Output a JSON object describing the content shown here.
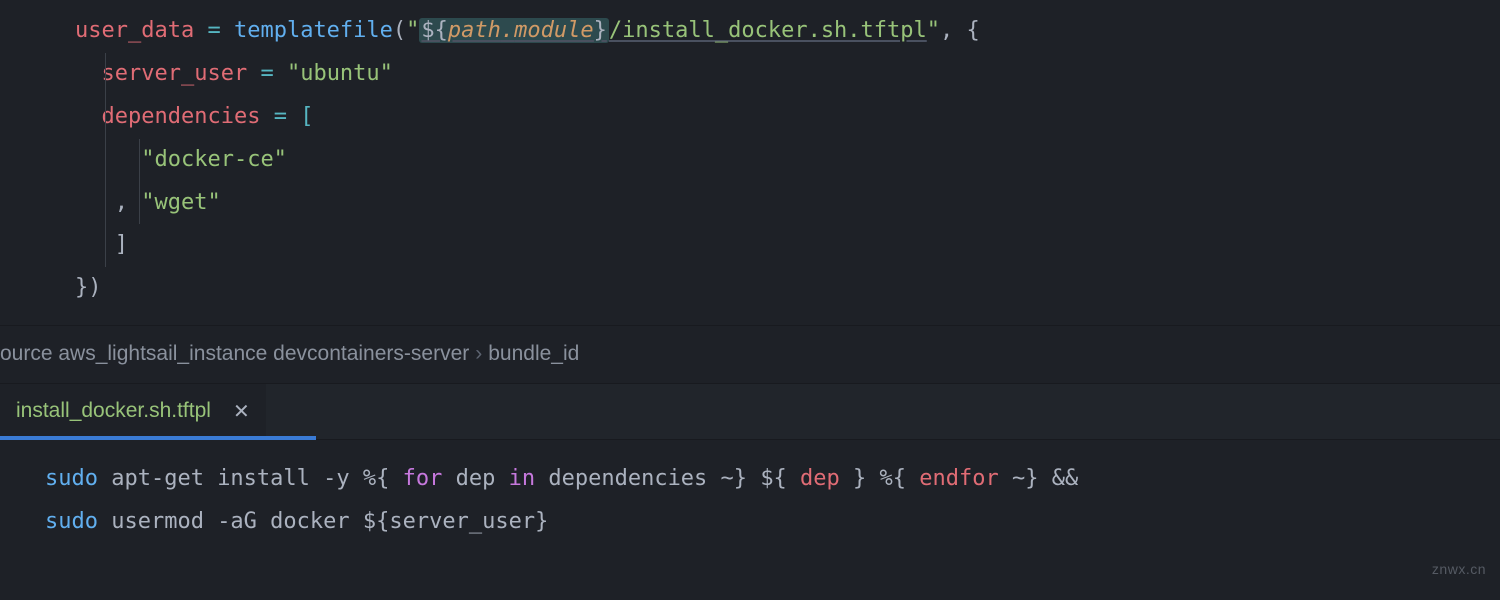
{
  "code_top": {
    "l1": {
      "key": "user_data",
      "eq": " = ",
      "fn": "templatefile",
      "open": "(",
      "q1": "\"",
      "interp_open": "${",
      "path": "path",
      "dot": ".",
      "module": "module",
      "interp_close": "}",
      "rest": "/install_docker.sh.tftpl",
      "q2": "\"",
      "comma": ", {"
    },
    "l2": {
      "key": "server_user",
      "eq": " = ",
      "val": "\"ubuntu\""
    },
    "l3": {
      "key": "dependencies",
      "eq": " = [",
      "rest": ""
    },
    "l4": {
      "val": "\"docker-ce\""
    },
    "l5": {
      "comma": ", ",
      "val": "\"wget\""
    },
    "l6": {
      "close": "]"
    },
    "l7": {
      "close": "})"
    }
  },
  "breadcrumb": {
    "a": "ource aws_lightsail_instance devcontainers-server",
    "b": "bundle_id"
  },
  "tab": {
    "name": "install_docker.sh.tftpl"
  },
  "code_bottom": {
    "l1": {
      "sudo": "sudo",
      "rest1": " apt-get install -y ",
      "pct1": "%{",
      "for": " for ",
      "dep1": "dep",
      "in": " in ",
      "deps": "dependencies",
      "tilde1": " ~}",
      "sp1": " ",
      "dol": "${",
      "dep2": " dep ",
      "cb": "}",
      "sp2": " ",
      "pct2": "%{",
      "endfor": " endfor ",
      "tilde2": "~}",
      "amp": " &&"
    },
    "l2": {
      "sudo": "sudo",
      "rest": " usermod -aG docker ",
      "dol": "${",
      "var": "server_user",
      "cb": "}"
    }
  },
  "watermark": "znwx.cn"
}
